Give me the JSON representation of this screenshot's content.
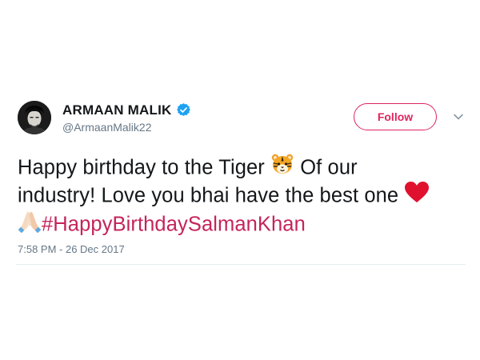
{
  "user": {
    "name": "ARMAAN MALIK",
    "handle": "@ArmaanMalik22",
    "verified": true
  },
  "actions": {
    "follow_label": "Follow",
    "menu_icon": "chevron-down-icon"
  },
  "tweet": {
    "line1_text": "Happy birthday to the Tiger",
    "line1_emoji": "tiger-face-icon",
    "line1_after": "Of our",
    "line2_text": "industry! Love you bhai have the best one",
    "line2_emoji": "red-heart-icon",
    "line3_emoji": "folded-hands-icon",
    "hashtag": "#HappyBirthdaySalmanKhan"
  },
  "timestamp": "7:58 PM - 26 Dec 2017",
  "colors": {
    "accent": "#e0245e",
    "hashtag": "#c5245b",
    "verified": "#1da1f2",
    "muted": "#657786",
    "heart": "#e0112f"
  }
}
